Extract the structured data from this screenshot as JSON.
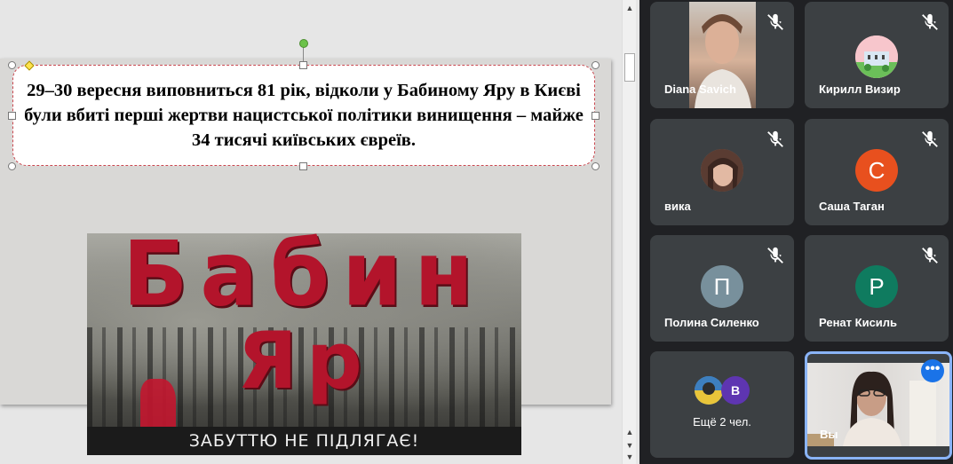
{
  "slide": {
    "text": "29–30 вересня виповниться  81 рік, відколи у Бабиному Яру в Києві були вбиті перші жертви нацистської політики винищення  – майже 34 тисячі київських  євреїв.",
    "poster": {
      "word1": "Бабин",
      "word2": "Яр",
      "banner": "ЗАБУТТЮ НЕ ПІДЛЯГАЄ!"
    }
  },
  "participants": [
    {
      "name": "Diana Savich",
      "muted": true,
      "video": true
    },
    {
      "name": "Кирилл Визир",
      "muted": true,
      "video": false
    },
    {
      "name": "вика",
      "muted": true,
      "video": false
    },
    {
      "name": "Саша Таган",
      "muted": true,
      "video": false,
      "initial": "С",
      "color": "#e8501e"
    },
    {
      "name": "Полина Силенко",
      "muted": true,
      "video": false,
      "initial": "П",
      "color": "#78909c"
    },
    {
      "name": "Ренат Кисиль",
      "muted": true,
      "video": false,
      "initial": "Р",
      "color": "#0f7b5f"
    }
  ],
  "more": {
    "label": "Ещё 2 чел.",
    "initial": "В",
    "color": "#5e35b1"
  },
  "self": {
    "name": "Вы",
    "more_icon": "•••"
  },
  "icons": {
    "mic_off": "mic-off-icon",
    "more": "more-horiz-icon"
  }
}
